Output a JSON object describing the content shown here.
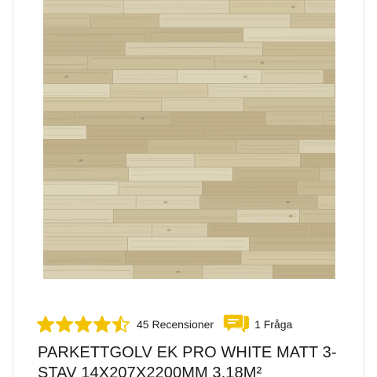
{
  "product": {
    "image_alt": "Parkettgolv ek white matt",
    "rating": 4.5,
    "rating_max": 5,
    "reviews_label": "45 Recensioner",
    "questions_label": "1 Fråga",
    "title": "PARKETTGOLV EK PRO WHITE MATT 3-STAV 14X207X2200MM 3,18M²"
  },
  "icons": {
    "star": "star-icon",
    "question": "speech-bubble-icon"
  },
  "colors": {
    "star": "#f2c200",
    "question_icon": "#f2c200",
    "text": "#1b1b1b",
    "wood_base": "#cbbf9d"
  }
}
